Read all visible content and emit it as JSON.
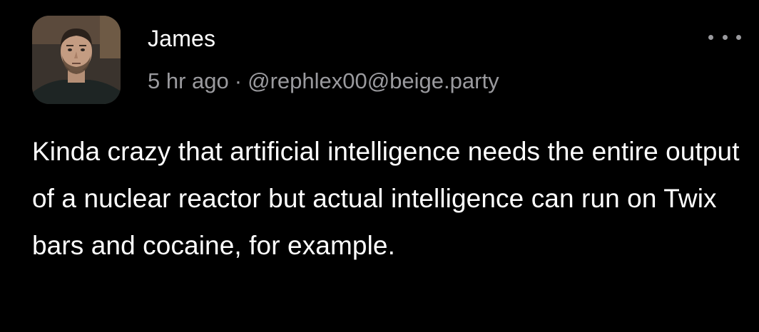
{
  "post": {
    "author": {
      "name": "James",
      "avatar_icon": "profile-photo"
    },
    "timestamp": "5 hr ago",
    "separator": "·",
    "handle": "@rephlex00@beige.party",
    "more_icon": "ellipsis-icon",
    "body": "Kinda crazy that artificial intelligence needs the entire output of a nuclear reactor but actual intelligence can run on Twix bars and cocaine, for example."
  },
  "colors": {
    "background": "#000000",
    "text_primary": "#ffffff",
    "text_secondary": "#9a9a9e"
  }
}
